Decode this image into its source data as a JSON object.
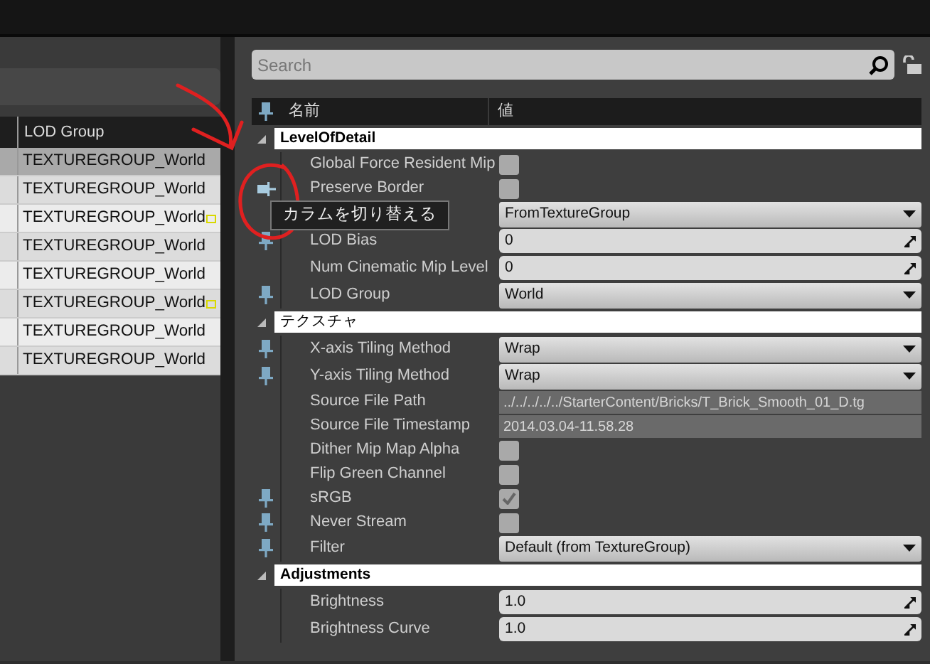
{
  "left_table": {
    "columns": [
      "LOD Group"
    ],
    "rows": [
      {
        "cell": "TEXTUREGROUP_World",
        "selected": true,
        "flag": false
      },
      {
        "cell": "TEXTUREGROUP_World",
        "selected": false,
        "flag": false
      },
      {
        "cell": "TEXTUREGROUP_World",
        "selected": false,
        "flag": true
      },
      {
        "cell": "TEXTUREGROUP_World",
        "selected": false,
        "flag": false
      },
      {
        "cell": "TEXTUREGROUP_World",
        "selected": false,
        "flag": false
      },
      {
        "cell": "TEXTUREGROUP_World",
        "selected": false,
        "flag": true
      },
      {
        "cell": "TEXTUREGROUP_World",
        "selected": false,
        "flag": false
      },
      {
        "cell": "TEXTUREGROUP_World",
        "selected": false,
        "flag": false
      }
    ]
  },
  "details": {
    "search": {
      "placeholder": "Search"
    },
    "columns": [
      "名前",
      "値"
    ],
    "categories": [
      {
        "title": "LevelOfDetail",
        "bold": true,
        "expanded": true,
        "properties": [
          {
            "name": "Global Force Resident Mip",
            "kind": "checkbox",
            "checked": false,
            "pinned": false,
            "hovered": false
          },
          {
            "name": "Preserve Border",
            "kind": "checkbox",
            "checked": false,
            "pinned": false,
            "hovered": true
          },
          {
            "kind": "dropdown",
            "value": "FromTextureGroup",
            "pinned": false,
            "hovered": false
          },
          {
            "name": "LOD Bias",
            "kind": "number",
            "value": "0",
            "pinned": true,
            "hovered": false
          },
          {
            "name": "Num Cinematic Mip Level",
            "kind": "number",
            "value": "0",
            "pinned": false,
            "hovered": false
          },
          {
            "name": "LOD Group",
            "kind": "dropdown",
            "value": "World",
            "pinned": true,
            "hovered": false
          }
        ]
      },
      {
        "title": "テクスチャ",
        "bold": false,
        "expanded": true,
        "properties": [
          {
            "name": "X-axis Tiling Method",
            "kind": "dropdown",
            "value": "Wrap",
            "pinned": true,
            "hovered": false
          },
          {
            "name": "Y-axis Tiling Method",
            "kind": "dropdown",
            "value": "Wrap",
            "pinned": true,
            "hovered": false
          },
          {
            "name": "Source File Path",
            "kind": "readonly",
            "value": "../../../../../StarterContent/Bricks/T_Brick_Smooth_01_D.tg",
            "pinned": false,
            "hovered": false
          },
          {
            "name": "Source File Timestamp",
            "kind": "readonly",
            "value": "2014.03.04-11.58.28",
            "pinned": false,
            "hovered": false
          },
          {
            "name": "Dither Mip Map Alpha",
            "kind": "checkbox",
            "checked": false,
            "pinned": false,
            "hovered": false
          },
          {
            "name": "Flip Green Channel",
            "kind": "checkbox",
            "checked": false,
            "pinned": false,
            "hovered": false
          },
          {
            "name": "sRGB",
            "kind": "checkbox",
            "checked": true,
            "pinned": true,
            "hovered": false
          },
          {
            "name": "Never Stream",
            "kind": "checkbox",
            "checked": false,
            "pinned": true,
            "hovered": false
          },
          {
            "name": "Filter",
            "kind": "dropdown",
            "value": "Default (from TextureGroup)",
            "pinned": true,
            "hovered": false
          }
        ]
      },
      {
        "title": "Adjustments",
        "bold": true,
        "expanded": true,
        "properties": [
          {
            "name": "Brightness",
            "kind": "number",
            "value": "1.0",
            "pinned": false,
            "hovered": false
          },
          {
            "name": "Brightness Curve",
            "kind": "number",
            "value": "1.0",
            "pinned": false,
            "hovered": false
          }
        ]
      }
    ]
  },
  "tooltip": {
    "text": "カラムを切り替える"
  }
}
